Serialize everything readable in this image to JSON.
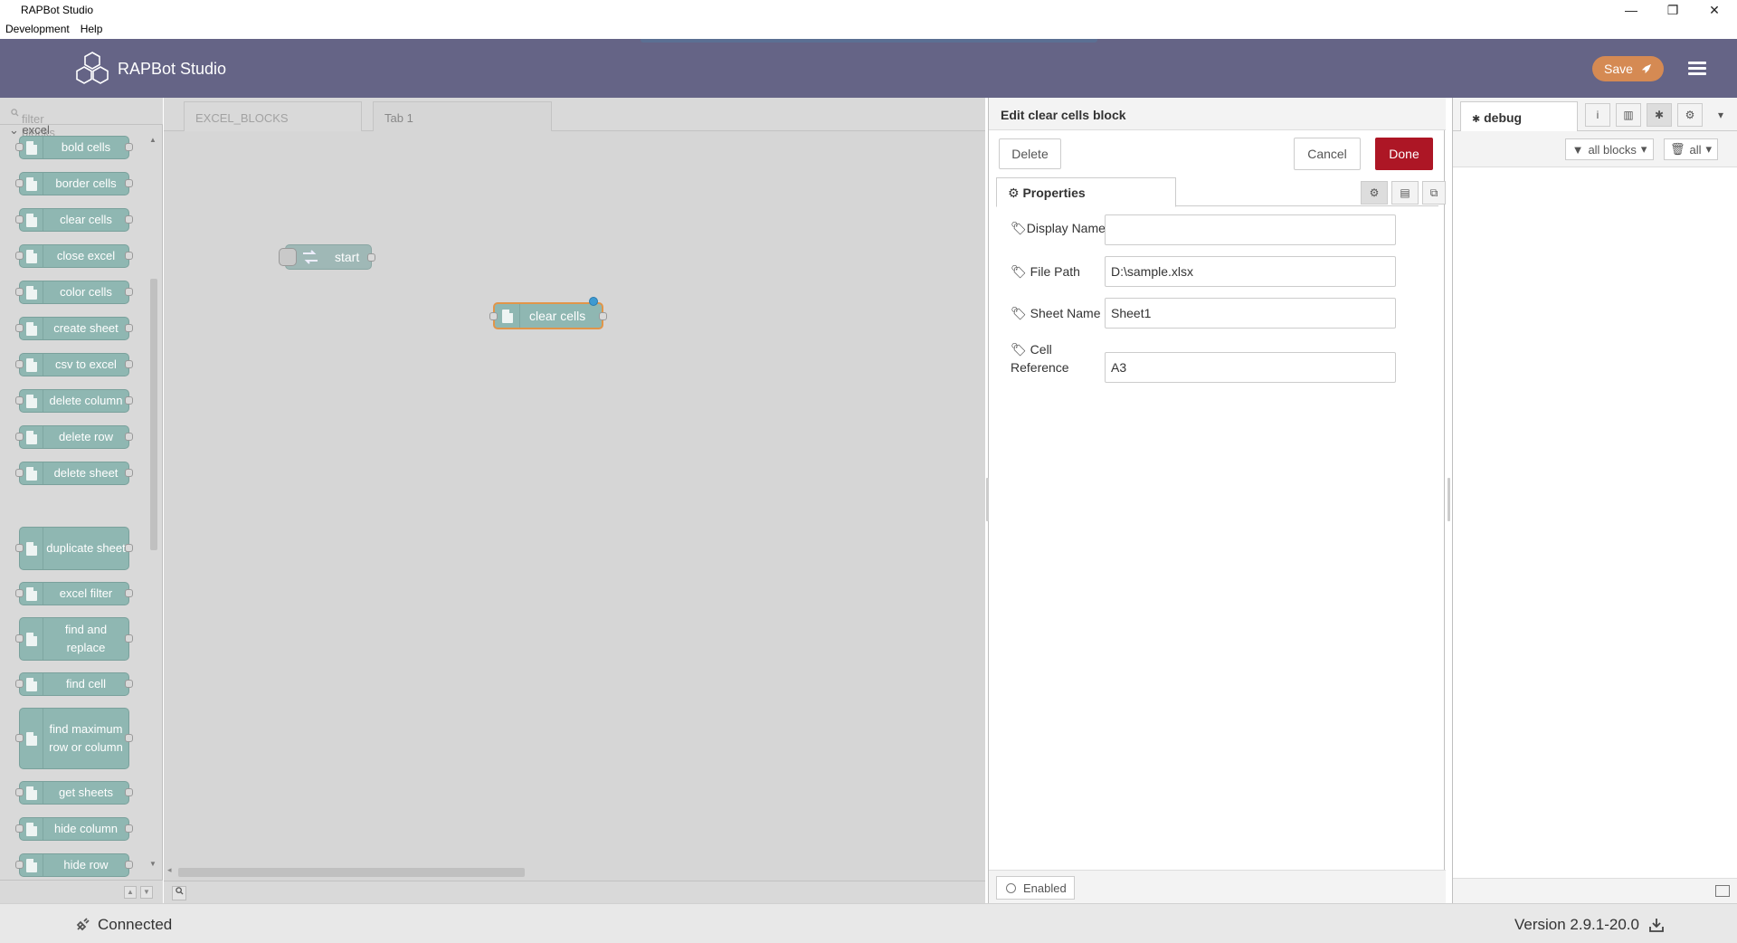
{
  "window": {
    "title": "RAPBot Studio",
    "controls": {
      "minimize": "—",
      "restore": "❐",
      "close": "✕"
    }
  },
  "menubar": {
    "items": [
      "Development",
      "Help"
    ]
  },
  "header": {
    "brand": "RAPBot Studio",
    "save_label": "Save"
  },
  "palette": {
    "filter_placeholder": "filter blocks",
    "category": "excel",
    "blocks": [
      {
        "label": "bold cells"
      },
      {
        "label": "border cells"
      },
      {
        "label": "clear cells"
      },
      {
        "label": "close excel"
      },
      {
        "label": "color cells"
      },
      {
        "label": "create sheet"
      },
      {
        "label": "csv to excel"
      },
      {
        "label": "delete column"
      },
      {
        "label": "delete row"
      },
      {
        "label": "delete sheet"
      },
      {
        "label": "duplicate sheet"
      },
      {
        "label": "excel filter"
      },
      {
        "label": "find and replace"
      },
      {
        "label": "find cell"
      },
      {
        "label": "find maximum row or column"
      },
      {
        "label": "get sheets"
      },
      {
        "label": "hide column"
      },
      {
        "label": "hide row"
      }
    ]
  },
  "workspace": {
    "tabs": [
      "EXCEL_BLOCKS",
      "Tab 1"
    ],
    "active_tab": "Tab 1",
    "nodes": {
      "start": "start",
      "clear_cells": "clear cells"
    }
  },
  "editor": {
    "title": "Edit clear cells block",
    "delete_label": "Delete",
    "cancel_label": "Cancel",
    "done_label": "Done",
    "properties_tab": "Properties",
    "fields": {
      "display_name": {
        "label": "Display Name",
        "value": ""
      },
      "file_path": {
        "label": "File Path",
        "value": "D:\\sample.xlsx"
      },
      "sheet_name": {
        "label": "Sheet Name",
        "value": "Sheet1"
      },
      "cell_reference": {
        "label": "Cell Reference",
        "value": "A3"
      }
    },
    "enabled_label": "Enabled"
  },
  "sidebar": {
    "tab_label": "debug",
    "filter_label": "all blocks",
    "clear_label": "all"
  },
  "status": {
    "connection": "Connected",
    "version": "Version 2.9.1-20.0"
  },
  "colors": {
    "header": "#656486",
    "save": "#d58a53",
    "done": "#ad1625",
    "block": "#8fb7b2"
  }
}
